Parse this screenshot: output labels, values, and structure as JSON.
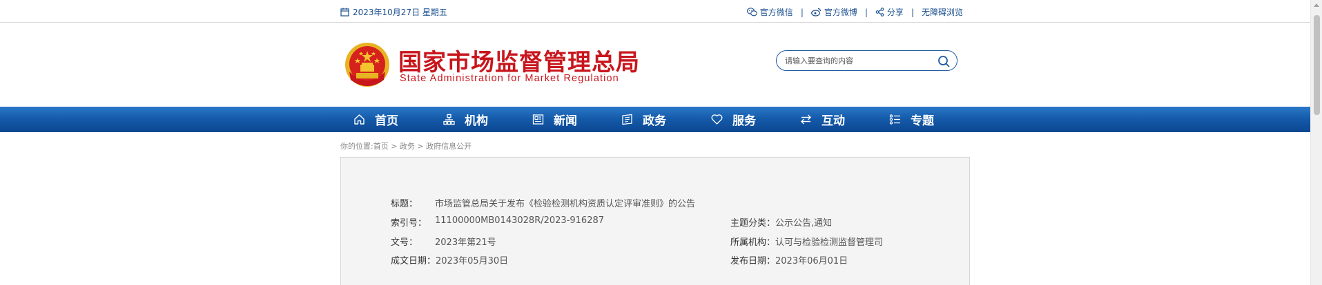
{
  "topbar": {
    "date": "2023年10月27日 星期五",
    "links": [
      {
        "icon": "wechat-icon",
        "label": "官方微信"
      },
      {
        "icon": "weibo-icon",
        "label": "官方微博"
      },
      {
        "icon": "share-icon",
        "label": "分享"
      },
      {
        "icon": "",
        "label": "无障碍浏览"
      }
    ],
    "separator": "|"
  },
  "header": {
    "title_cn": "国家市场监督管理总局",
    "title_en": "State Administration for Market Regulation",
    "search_placeholder": "请输入要查询的内容"
  },
  "nav": [
    {
      "icon": "home-icon",
      "label": "首页"
    },
    {
      "icon": "org-chart-icon",
      "label": "机构"
    },
    {
      "icon": "news-icon",
      "label": "新闻"
    },
    {
      "icon": "document-icon",
      "label": "政务"
    },
    {
      "icon": "heart-icon",
      "label": "服务"
    },
    {
      "icon": "exchange-icon",
      "label": "互动"
    },
    {
      "icon": "list-icon",
      "label": "专题"
    }
  ],
  "breadcrumb": "你的位置:首页 > 政务 > 政府信息公开",
  "info": {
    "title_label": "标题：",
    "title_value": "市场监管总局关于发布《检验检测机构资质认定评审准则》的公告",
    "index_label": "索引号：",
    "index_value": "11100000MB0143028R/2023-916287",
    "topic_label": "主题分类：",
    "topic_value": "公示公告,通知",
    "docno_label": "文号：",
    "docno_value": "2023年第21号",
    "org_label": "所属机构：",
    "org_value": "认可与检验检测监督管理司",
    "created_label": "成文日期：",
    "created_value": "2023年05月30日",
    "published_label": "发布日期：",
    "published_value": "2023年06月01日"
  },
  "colors": {
    "brand_red": "#c8161d",
    "nav_blue": "#1459a8",
    "link_blue": "#1a4f8f"
  }
}
